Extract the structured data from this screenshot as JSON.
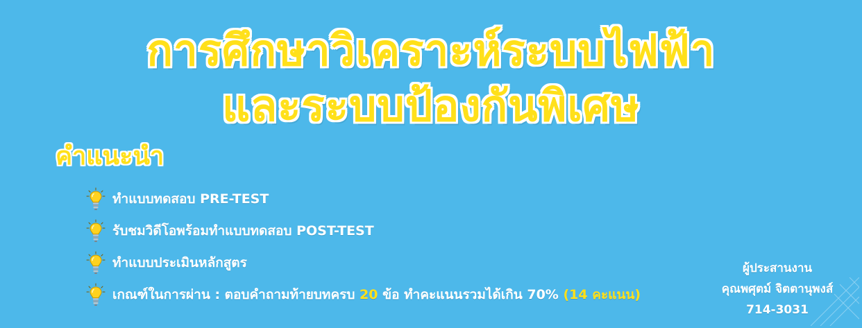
{
  "colors": {
    "background": "#4db8ea",
    "title": "#ffe01a",
    "title_outline": "#ffffff",
    "text": "#ffffff",
    "highlight": "#ffe01a"
  },
  "title": {
    "line1": "การศึกษาวิเคราะห์ระบบไฟฟ้า",
    "line2": "และระบบป้องกันพิเศษ"
  },
  "instructions": {
    "heading": "คำแนะนำ",
    "bullet_icon": "lightbulb-icon",
    "items": [
      {
        "text": "ทำแบบทดสอบ PRE-TEST"
      },
      {
        "text": "รับชมวิดีโอพร้อมทำแบบทดสอบ POST-TEST"
      },
      {
        "text": "ทำแบบประเมินหลักสูตร"
      },
      {
        "text_before": "เกณฑ์ในการผ่าน : ตอบคำถามท้ายบทครบ ",
        "highlight_count": "20",
        "text_middle": " ข้อ ทำคะแนนรวมได้เกิน 70%  ",
        "highlight_score": "(14 คะแนน)"
      }
    ]
  },
  "contact": {
    "label": "ผู้ประสานงาน",
    "name": "คุณพศุตม์ จิตตานุพงส์",
    "phone": "714-3031"
  }
}
